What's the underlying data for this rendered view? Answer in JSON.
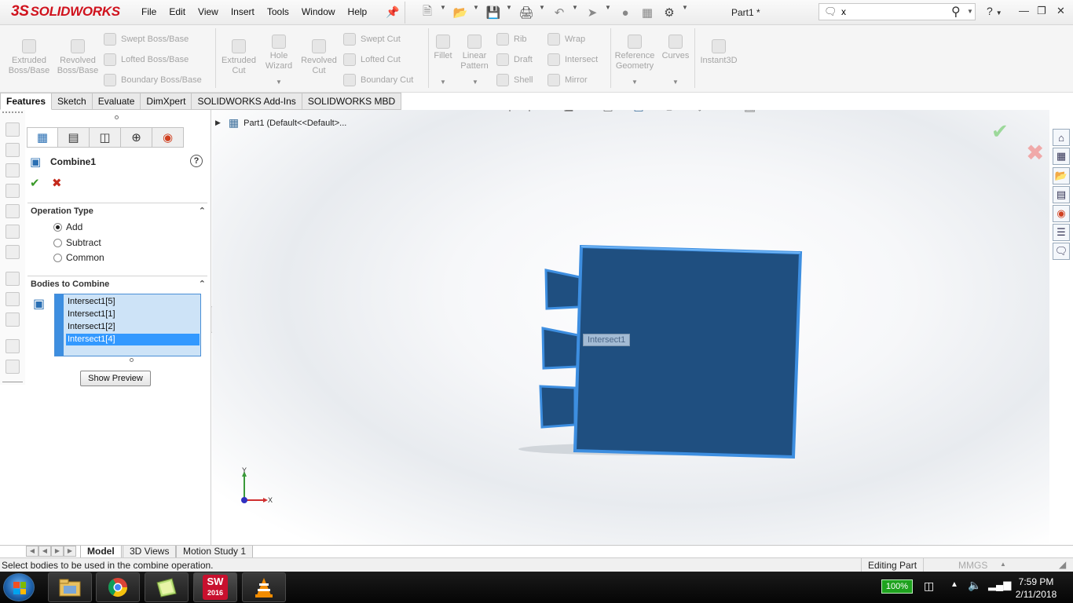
{
  "app": {
    "logo_ds": "3S",
    "logo_text": "SOLIDWORKS",
    "doc_title": "Part1 *",
    "menu": [
      "File",
      "Edit",
      "View",
      "Insert",
      "Tools",
      "Window",
      "Help"
    ],
    "search_value": "x",
    "help_label": "?"
  },
  "toolbar": {
    "extruded_boss": "Extruded Boss/Base",
    "revolved_boss": "Revolved Boss/Base",
    "swept_boss": "Swept Boss/Base",
    "lofted_boss": "Lofted Boss/Base",
    "boundary_boss": "Boundary Boss/Base",
    "extruded_cut": "Extruded Cut",
    "hole_wizard": "Hole Wizard",
    "revolved_cut": "Revolved Cut",
    "swept_cut": "Swept Cut",
    "lofted_cut": "Lofted Cut",
    "boundary_cut": "Boundary Cut",
    "fillet": "Fillet",
    "linear_pattern": "Linear Pattern",
    "rib": "Rib",
    "draft": "Draft",
    "shell": "Shell",
    "wrap": "Wrap",
    "intersect": "Intersect",
    "mirror": "Mirror",
    "reference_geometry": "Reference Geometry",
    "curves": "Curves",
    "instant3d": "Instant3D"
  },
  "tabs": [
    "Features",
    "Sketch",
    "Evaluate",
    "DimXpert",
    "SOLIDWORKS Add-Ins",
    "SOLIDWORKS MBD"
  ],
  "property_manager": {
    "title": "Combine1",
    "help": "?",
    "operation_type": {
      "header": "Operation Type",
      "options": [
        "Add",
        "Subtract",
        "Common"
      ],
      "selected": "Add"
    },
    "bodies": {
      "header": "Bodies to Combine",
      "items": [
        "Intersect1[5]",
        "Intersect1[1]",
        "Intersect1[2]",
        "Intersect1[4]"
      ],
      "selected_index": 3
    },
    "show_preview": "Show Preview"
  },
  "graphics": {
    "tree_label": "Part1  (Default<<Default>...",
    "tooltip": "Intersect1",
    "axis_x": "X",
    "axis_y": "Y",
    "model_color": "#1f4f80",
    "edge_color": "#3d8ee0"
  },
  "bottom_tabs": [
    "Model",
    "3D Views",
    "Motion Study 1"
  ],
  "status": {
    "message": "Select bodies to be used in the combine operation.",
    "mode": "Editing Part",
    "units": "MMGS"
  },
  "taskbar": {
    "battery": "100%",
    "sw_year": "2016",
    "time": "7:59 PM",
    "date": "2/11/2018"
  },
  "colors": {
    "brand_red": "#d0121d",
    "selection_blue": "#3399ff",
    "accept_green": "#9cd89a",
    "reject_red": "#f0a9a9"
  }
}
